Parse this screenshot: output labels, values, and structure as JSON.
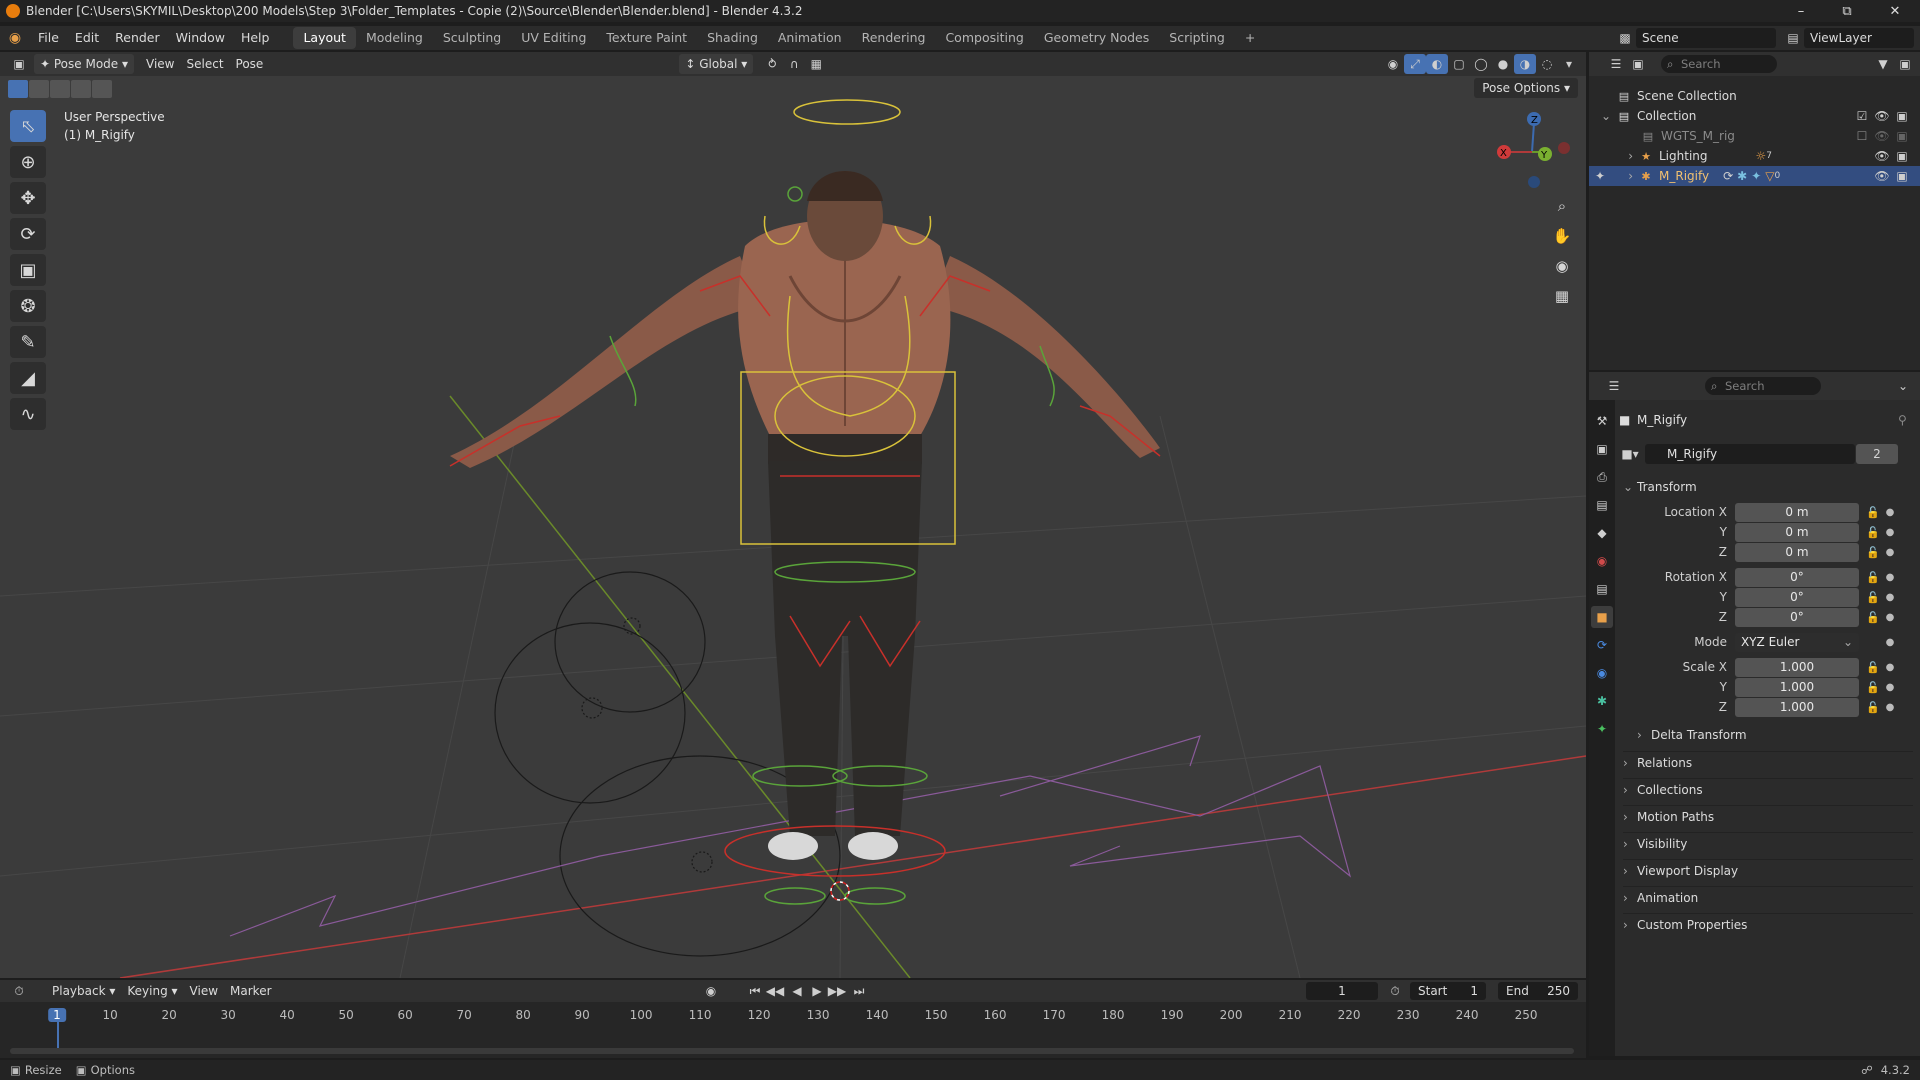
{
  "window": {
    "title": "Blender [C:\\Users\\SKYMIL\\Desktop\\200 Models\\Step 3\\Folder_Templates - Copie (2)\\Source\\Blender\\Blender.blend] - Blender 4.3.2",
    "minimize": "–",
    "maximize": "⧉",
    "close": "✕"
  },
  "menus": [
    "File",
    "Edit",
    "Render",
    "Window",
    "Help"
  ],
  "workspaces": [
    "Layout",
    "Modeling",
    "Sculpting",
    "UV Editing",
    "Texture Paint",
    "Shading",
    "Animation",
    "Rendering",
    "Compositing",
    "Geometry Nodes",
    "Scripting"
  ],
  "workspace_add": "+",
  "scene": {
    "name": "Scene",
    "view_layer": "ViewLayer"
  },
  "viewport_header": {
    "mode": "Pose Mode",
    "menus": [
      "View",
      "Select",
      "Pose"
    ],
    "transform_orientation": "Global"
  },
  "viewport": {
    "perspective": "User Perspective",
    "object": "(1) M_Rigify",
    "pose_options": "Pose Options",
    "gizmo": {
      "x": "X",
      "y": "Y",
      "z": "Z"
    }
  },
  "outliner": {
    "search_placeholder": "Search",
    "rows": [
      {
        "label": "Scene Collection"
      },
      {
        "label": "Collection"
      },
      {
        "label": "WGTS_M_rig"
      },
      {
        "label": "Lighting",
        "badge": "7"
      },
      {
        "label": "M_Rigify",
        "badge": "0"
      }
    ]
  },
  "properties": {
    "search_placeholder": "Search",
    "object_name": "M_Rigify",
    "data_name": "M_Rigify",
    "users": "2",
    "transform": {
      "title": "Transform",
      "location_label": "Location X",
      "rotation_label": "Rotation X",
      "scale_label": "Scale X",
      "y_label": "Y",
      "z_label": "Z",
      "location": [
        "0 m",
        "0 m",
        "0 m"
      ],
      "rotation": [
        "0°",
        "0°",
        "0°"
      ],
      "mode_label": "Mode",
      "mode": "XYZ Euler",
      "scale": [
        "1.000",
        "1.000",
        "1.000"
      ]
    },
    "subpanel": "Delta Transform",
    "panels": [
      "Relations",
      "Collections",
      "Motion Paths",
      "Visibility",
      "Viewport Display",
      "Animation",
      "Custom Properties"
    ]
  },
  "timeline": {
    "menus": [
      "Playback",
      "Keying",
      "View",
      "Marker"
    ],
    "current_frame": "1",
    "start_label": "Start",
    "start": "1",
    "end_label": "End",
    "end": "250",
    "ruler": [
      "1",
      "10",
      "20",
      "30",
      "40",
      "50",
      "60",
      "70",
      "80",
      "90",
      "100",
      "110",
      "120",
      "130",
      "140",
      "150",
      "160",
      "170",
      "180",
      "190",
      "200",
      "210",
      "220",
      "230",
      "240",
      "250"
    ]
  },
  "statusbar": {
    "left1": "Resize",
    "left2": "Options",
    "version": "4.3.2"
  },
  "colors": {
    "accent": "#4772b3",
    "selected_row": "#334d80",
    "bone_yellow": "#d9c23a",
    "bone_red": "#c8302a",
    "bone_green": "#5aa43a"
  }
}
